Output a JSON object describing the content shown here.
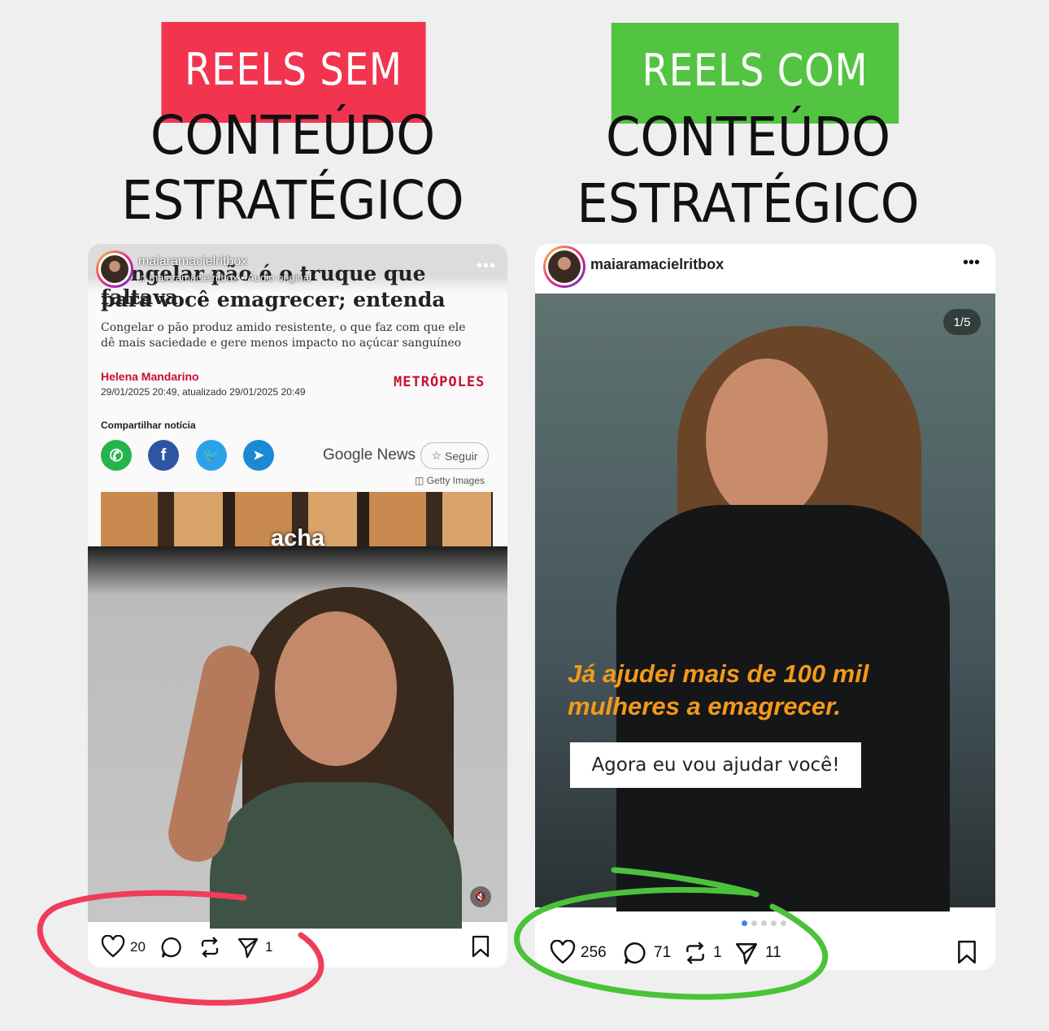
{
  "left": {
    "banner": "REELS SEM",
    "title_line1": "CONTEÚDO",
    "title_line2": "ESTRATÉGICO",
    "username": "maiaramacielritbox",
    "audio": "maiaramacielritbox • Áudio original",
    "article_title_line1": "Congelar pão é o truque que faltava",
    "article_title_line2": "para você emagrecer; entenda",
    "article_sub": "Congelar o pão produz amido resistente, o que faz com que ele dê mais saciedade e gere menos impacto no açúcar sanguíneo",
    "author": "Helena Mandarino",
    "date": "29/01/2025 20:49, atualizado 29/01/2025 20:49",
    "publisher": "METRÓPOLES",
    "share_label": "Compartilhar notícia",
    "google_news": "Google News",
    "follow": "Seguir",
    "getty": "Getty Images",
    "caption": "acha",
    "likes": "20",
    "shares": "1"
  },
  "right": {
    "banner": "REELS COM",
    "title_line1": "CONTEÚDO",
    "title_line2": "ESTRATÉGICO",
    "username": "maiaramacielritbox",
    "counter": "1/5",
    "headline_line1": "Já ajudei mais de 100 mil",
    "headline_line2": "mulheres a emagrecer.",
    "cta": "Agora eu vou ajudar você!",
    "likes": "256",
    "comments": "71",
    "reposts": "1",
    "shares": "11"
  },
  "colors": {
    "red_banner": "#f2344f",
    "green_banner": "#52c441",
    "red_circle": "#ef3d5a",
    "green_circle": "#4cc23a",
    "orange_text": "#f39a1a"
  }
}
